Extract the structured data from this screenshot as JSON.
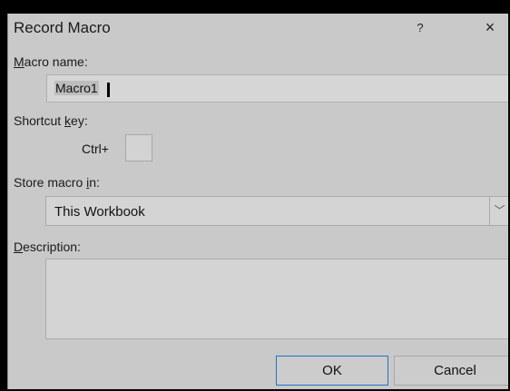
{
  "dialog": {
    "title": "Record Macro",
    "help_label": "?",
    "close_label": "×"
  },
  "macro_name": {
    "label_accel": "M",
    "label_rest": "acro name:",
    "value": "Macro1"
  },
  "shortcut": {
    "label_pre": "Shortcut ",
    "label_accel": "k",
    "label_post": "ey:",
    "ctrl_prefix": "Ctrl+",
    "value": ""
  },
  "store": {
    "label_pre": "Store macro ",
    "label_accel": "i",
    "label_post": "n:",
    "selected": "This Workbook",
    "dropdown_glyph": "﹀"
  },
  "description": {
    "label_accel": "D",
    "label_rest": "escription:",
    "value": ""
  },
  "buttons": {
    "ok": "OK",
    "cancel": "Cancel"
  },
  "colors": {
    "dialog_bg": "#c9c9c9",
    "field_bg": "#d4d4d4",
    "ok_border": "#1e73c8"
  }
}
